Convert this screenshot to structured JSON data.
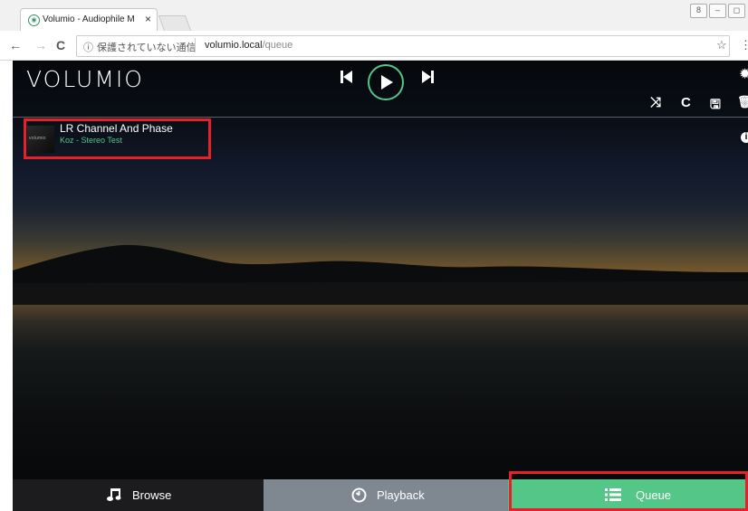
{
  "browser": {
    "tab_title": "Volumio - Audiophile M",
    "tab_close": "×",
    "back": "←",
    "forward": "→",
    "reload": "C",
    "info_glyph": "ⓘ",
    "insecure_label": "保護されていない通信",
    "url_host": "volumio.local",
    "url_path": "/queue",
    "star": "☆",
    "menu": "⋮",
    "window_controls": [
      "8",
      "–",
      "◻"
    ]
  },
  "app": {
    "logo": "VOLUMIO",
    "prev_icon": "skip-previous-icon",
    "play_icon": "play-icon",
    "next_icon": "skip-next-icon",
    "settings_icon": "gear-icon",
    "toolbar": {
      "shuffle": "⤨",
      "repeat": "C",
      "save": "🖫",
      "delete": "🗑"
    },
    "queue": [
      {
        "title": "LR Channel And Phase",
        "artist_album": "Koz - Stereo Test",
        "thumb_label": "volumio"
      }
    ],
    "info_glyph": "i"
  },
  "bottom_nav": {
    "browse": "Browse",
    "playback": "Playback",
    "queue": "Queue"
  },
  "colors": {
    "accent": "#54c688",
    "highlight": "#e8202a",
    "playback_bg": "#7f8891",
    "browse_bg": "#1c1c1e"
  }
}
